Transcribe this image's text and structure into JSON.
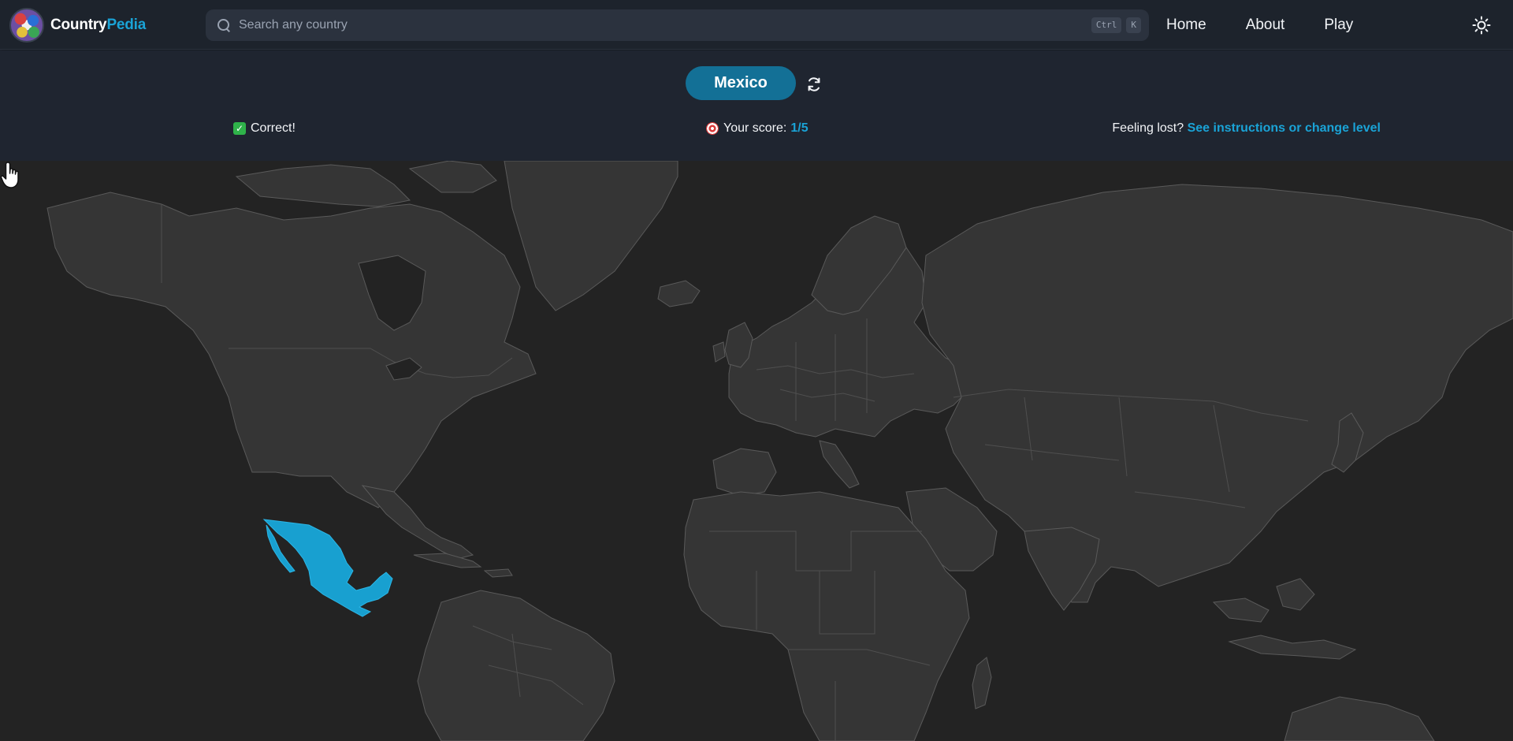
{
  "app": {
    "logo_part1": "Country",
    "logo_part2": "Pedia"
  },
  "search": {
    "placeholder": "Search any country",
    "shortcut_keys": [
      "Ctrl",
      "K"
    ]
  },
  "nav": {
    "items": [
      {
        "label": "Home"
      },
      {
        "label": "About"
      },
      {
        "label": "Play"
      }
    ],
    "theme_icon": "sun-icon"
  },
  "game": {
    "target_country": "Mexico",
    "status_text": "Correct!",
    "score_label": "Your score:",
    "score_value": "1/5",
    "help_prefix": "Feeling lost?",
    "help_link": "See instructions or change level"
  },
  "map": {
    "highlighted_country": "Mexico",
    "colors": {
      "background": "#232323",
      "land": "#353535",
      "border": "#5a5a5a",
      "highlight": "#18a0d0"
    }
  },
  "theme": {
    "accent": "#1aa3d6",
    "pill": "#137096",
    "navbar": "#1d232c",
    "page": "#1f2530"
  }
}
